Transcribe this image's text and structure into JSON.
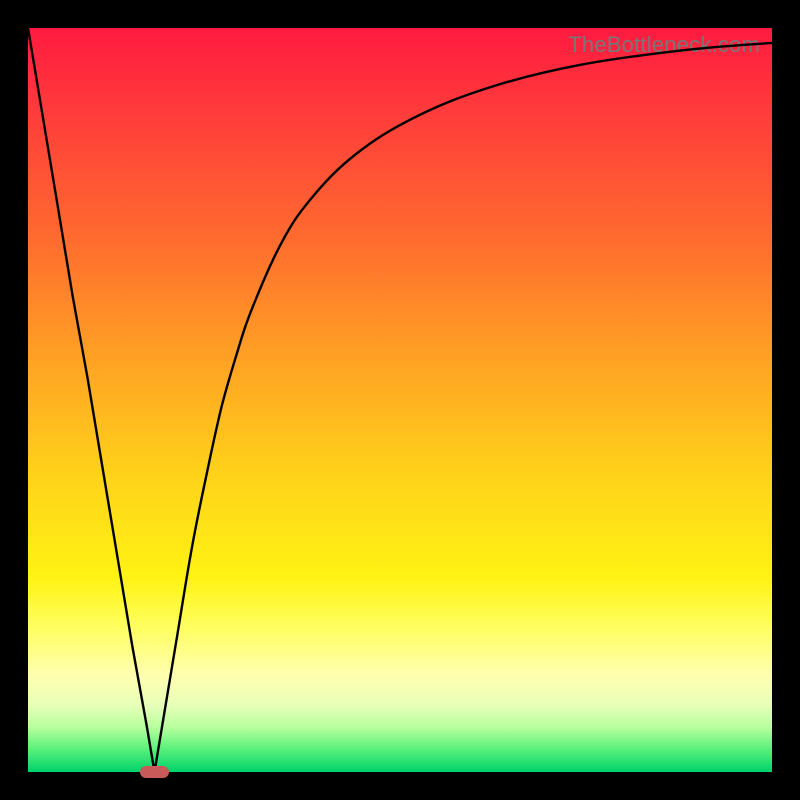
{
  "watermark": "TheBottleneck.com",
  "colors": {
    "top": "#ff1a40",
    "bottom": "#00d26a",
    "curve": "#000000",
    "marker": "#c85a5a",
    "frame": "#000000"
  },
  "chart_data": {
    "type": "line",
    "title": "",
    "xlabel": "",
    "ylabel": "",
    "xlim": [
      0,
      100
    ],
    "ylim": [
      0,
      100
    ],
    "x": [
      0,
      2,
      4,
      6,
      8,
      10,
      12,
      14,
      16,
      17,
      18,
      20,
      22,
      24,
      26,
      28,
      30,
      34,
      38,
      44,
      52,
      62,
      74,
      88,
      100
    ],
    "values": [
      100,
      88,
      76,
      64,
      53,
      41,
      29,
      17,
      6,
      0,
      6,
      18,
      30,
      40,
      49,
      56,
      62,
      71,
      77,
      83,
      88,
      92,
      95,
      97,
      98
    ],
    "min_x": 17,
    "min_value": 0,
    "marker_width_units": 4
  }
}
